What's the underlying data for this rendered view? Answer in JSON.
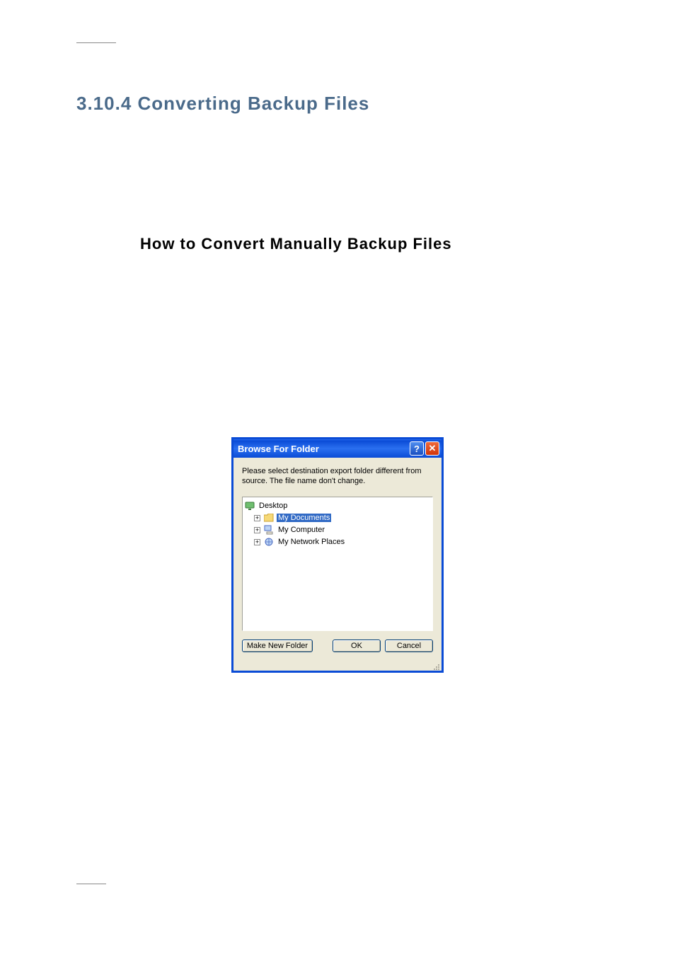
{
  "doc": {
    "section_heading": "3.10.4 Converting Backup Files",
    "sub_heading": "How to Convert Manually Backup Files"
  },
  "dialog": {
    "title": "Browse For Folder",
    "help_glyph": "?",
    "close_glyph": "✕",
    "instruction": "Please select destination export folder different from source. The file name don't change.",
    "tree": {
      "root": {
        "label": "Desktop",
        "icon": "desktop-icon",
        "children": [
          {
            "label": "My Documents",
            "icon": "folder-icon",
            "expandable": true,
            "selected": true
          },
          {
            "label": "My Computer",
            "icon": "computer-icon",
            "expandable": true,
            "selected": false
          },
          {
            "label": "My Network Places",
            "icon": "network-icon",
            "expandable": true,
            "selected": false
          }
        ]
      },
      "expand_glyph": "+"
    },
    "buttons": {
      "make_new_folder": "Make New Folder",
      "ok": "OK",
      "cancel": "Cancel"
    }
  },
  "colors": {
    "heading": "#4a6a8a",
    "titlebar": "#0a4bd6",
    "selection": "#316ac5",
    "dialog_bg": "#ece9d8"
  }
}
